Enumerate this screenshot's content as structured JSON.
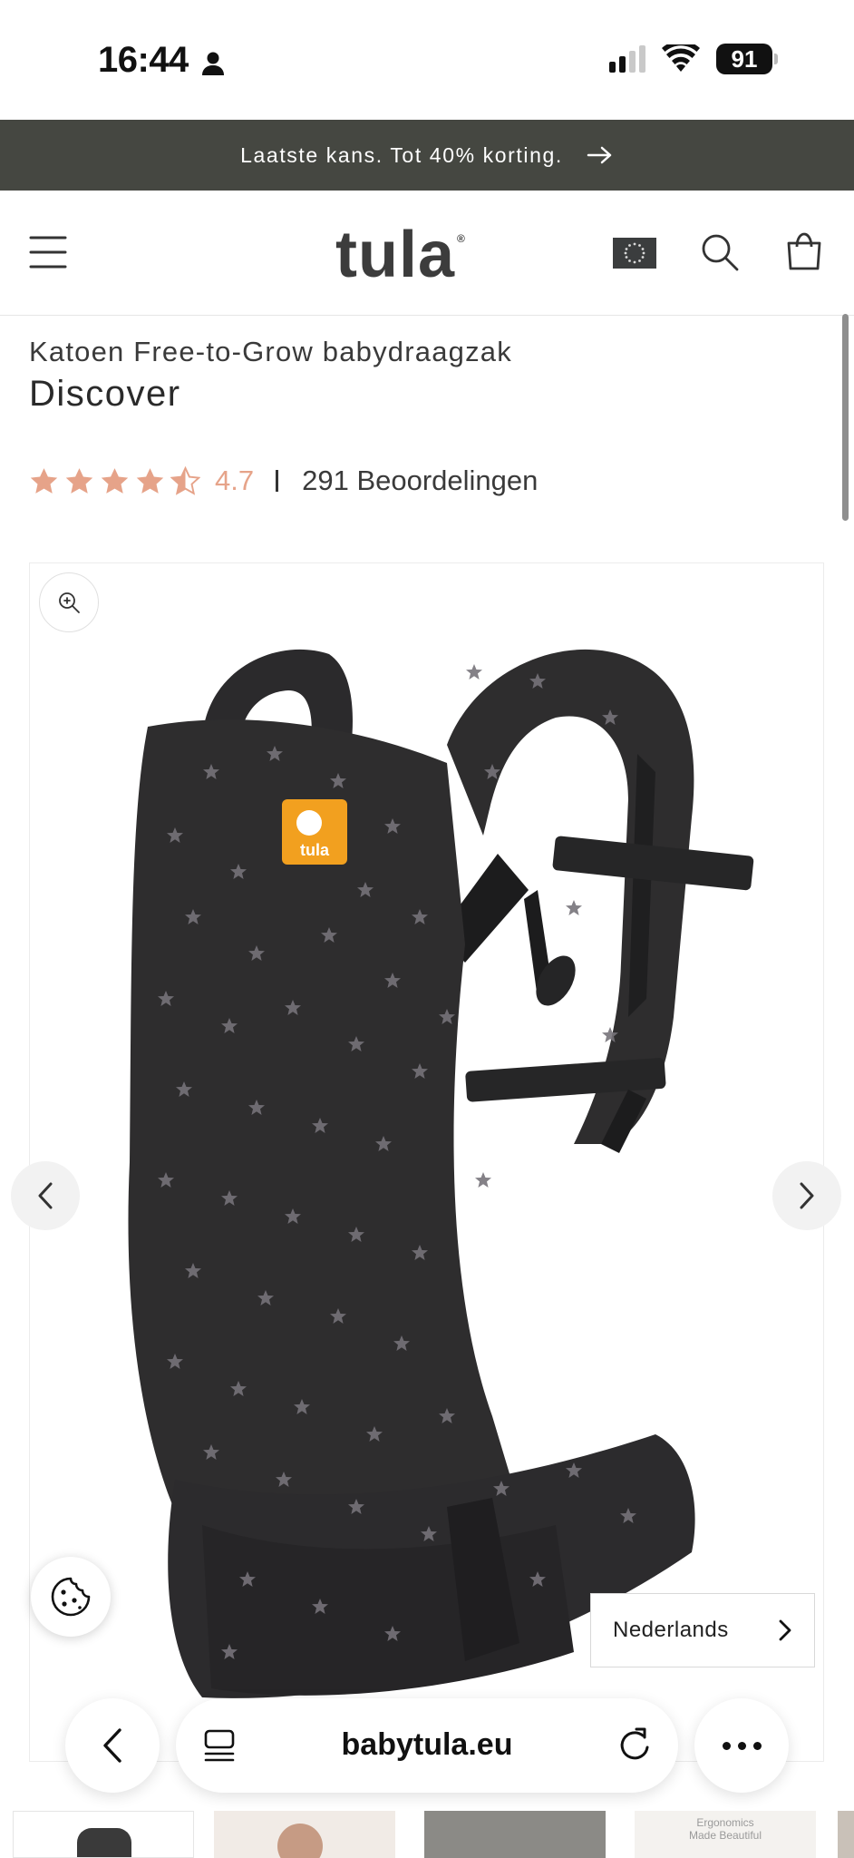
{
  "status_bar": {
    "time": "16:44",
    "battery": "91"
  },
  "announcement": {
    "text": "Laatste kans. Tot 40% korting."
  },
  "header": {
    "logo": "tula"
  },
  "product": {
    "subtitle": "Katoen Free-to-Grow babydraagzak",
    "title": "Discover",
    "rating_value": "4.7",
    "rating_stars": 4.5,
    "review_count": "291 Beoordelingen",
    "image_label": "tula"
  },
  "language": {
    "label": "Nederlands"
  },
  "browser": {
    "url": "babytula.eu"
  },
  "thumbnails": {
    "caption_line1": "Ergonomics",
    "caption_line2": "Made Beautiful"
  },
  "colors": {
    "announcement_bg": "#454741",
    "star": "#e6a389",
    "carrier": "#2e2d2e",
    "star_print": "#76737a",
    "logo_tag": "#f2a01f"
  }
}
